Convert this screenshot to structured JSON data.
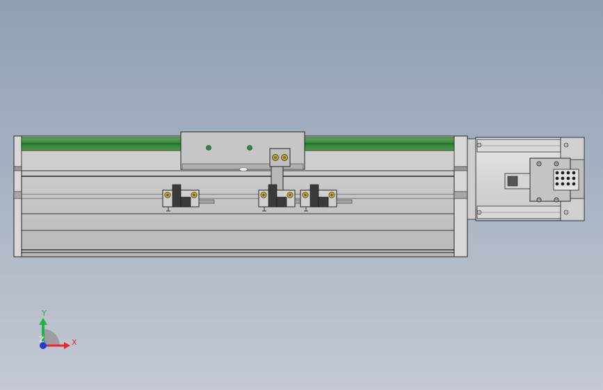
{
  "triad": {
    "x_label": "X",
    "y_label": "Y",
    "z_label": "Z",
    "x_color": "#e8262b",
    "y_color": "#21b24a",
    "z_color": "#1f3fd6"
  },
  "colors": {
    "rail_green": "#3c8a3c",
    "body_light": "#c9c9c9",
    "body_mid": "#b4b4b4",
    "outline": "#202020",
    "brass": "#c9a227"
  }
}
